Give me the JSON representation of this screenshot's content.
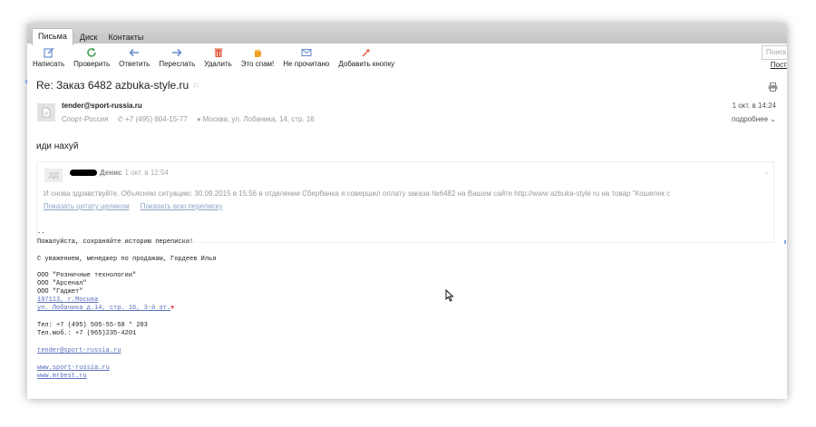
{
  "tabs": [
    "Письма",
    "Диск",
    "Контакты"
  ],
  "toolbar": [
    {
      "label": "Написать",
      "icon": "compose-icon",
      "color": "#6a8fd0"
    },
    {
      "label": "Проверить",
      "icon": "refresh-icon",
      "color": "#4aa356"
    },
    {
      "label": "Ответить",
      "icon": "reply-icon",
      "color": "#6a8fd0"
    },
    {
      "label": "Переслать",
      "icon": "forward-icon",
      "color": "#6a8fd0"
    },
    {
      "label": "Удалить",
      "icon": "trash-icon",
      "color": "#e05a3a"
    },
    {
      "label": "Это спам!",
      "icon": "spam-hand-icon",
      "color": "#f0a020"
    },
    {
      "label": "Не прочитано",
      "icon": "envelope-icon",
      "color": "#6a8fd0"
    },
    {
      "label": "Добавить кнопку",
      "icon": "add-button-icon",
      "color": "#e05a3a"
    }
  ],
  "search": {
    "placeholder": "Поиск",
    "link": "Поста"
  },
  "message": {
    "subject": "Re: Заказ 6482 azbuka-style.ru",
    "sender_email": "tender@sport-russia.ru",
    "company": "Спорт-Россия",
    "phone": "+7 (495) 604-15-77",
    "address": "Москва, ул. Лобачика, 14, стр. 16",
    "date": "1 окт. в 14:24",
    "details": "подробнее",
    "body": "иди нахуй"
  },
  "quote": {
    "avatar_initials": "ДД",
    "name": "Денис",
    "time": "1 окт. в 12:54",
    "text": "И снова здравствуйте. Объясняю ситуацию: 30.09.2015 в 15:56 в отделении Сбербанка я совершил оплату заказа №6482 на Вашем сайте http://www azbuka-style ru на товар \"Кошелек с",
    "link_full": "Показать цитату целиком",
    "link_thread": "Показать всю переписку"
  },
  "signature": {
    "dash": "--",
    "keep_history": "Пожалуйста, сохраняйте историю переписки!",
    "regards": "С уважением, менеджер по продажам, Гордеев Илья",
    "org1": "ООО \"Розничные технологии\"",
    "org2": "ООО \"Арсенал\"",
    "org3": "ООО \"Гаджет\"",
    "addr1": "107113, г.Москва",
    "addr2": "ул. Лобачика д.14, стр. 16, 3-й эт.",
    "tel": "Тел: +7 (495) 505-55-58 * 203",
    "mob": "Тел.моб.: +7 (965)235-4201",
    "email": "tender@sport-russia.ru",
    "site1": "www.sport-russia.ru",
    "site2": "www.mrbest.ru"
  }
}
